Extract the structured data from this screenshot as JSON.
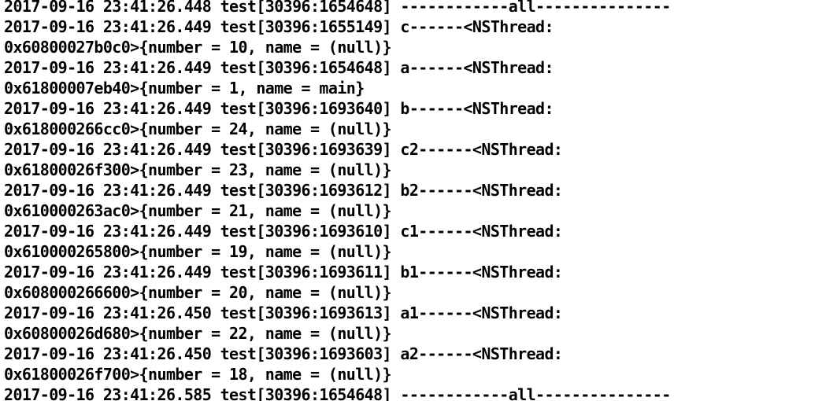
{
  "console": {
    "lines": [
      "2017-09-16 23:41:26.448 test[30396:1654648] ------------all---------------",
      "2017-09-16 23:41:26.449 test[30396:1655149] c------<NSThread:",
      "0x60800027b0c0>{number = 10, name = (null)}",
      "2017-09-16 23:41:26.449 test[30396:1654648] a------<NSThread:",
      "0x61800007eb40>{number = 1, name = main}",
      "2017-09-16 23:41:26.449 test[30396:1693640] b------<NSThread:",
      "0x618000266cc0>{number = 24, name = (null)}",
      "2017-09-16 23:41:26.449 test[30396:1693639] c2------<NSThread:",
      "0x61800026f300>{number = 23, name = (null)}",
      "2017-09-16 23:41:26.449 test[30396:1693612] b2------<NSThread:",
      "0x610000263ac0>{number = 21, name = (null)}",
      "2017-09-16 23:41:26.449 test[30396:1693610] c1------<NSThread:",
      "0x610000265800>{number = 19, name = (null)}",
      "2017-09-16 23:41:26.449 test[30396:1693611] b1------<NSThread:",
      "0x608000266600>{number = 20, name = (null)}",
      "2017-09-16 23:41:26.450 test[30396:1693613] a1------<NSThread:",
      "0x60800026d680>{number = 22, name = (null)}",
      "2017-09-16 23:41:26.450 test[30396:1693603] a2------<NSThread:",
      "0x61800026f700>{number = 18, name = (null)}",
      "2017-09-16 23:41:26.585 test[30396:1654648] ------------all---------------"
    ]
  }
}
